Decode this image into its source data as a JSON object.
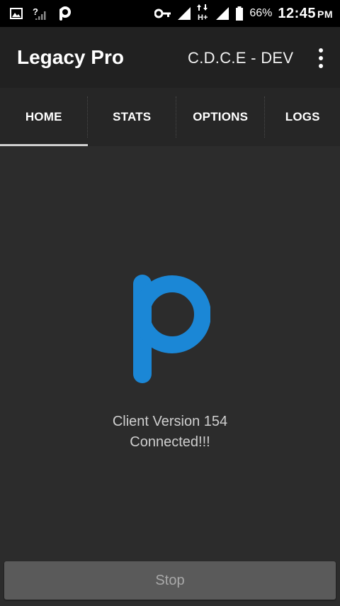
{
  "status_bar": {
    "left_icons": [
      "image-icon",
      "signal-off-icon",
      "app-p-icon"
    ],
    "right_icons": [
      "key-icon",
      "signal-icon",
      "data-arrows-icon",
      "signal-icon-2",
      "battery-icon"
    ],
    "network_type": "H+",
    "battery_percent": "66%",
    "time": "12:45",
    "ampm": "PM"
  },
  "toolbar": {
    "title": "Legacy Pro",
    "subtitle": "C.D.C.E - DEV",
    "menu_icon": "more-vert-icon"
  },
  "tabs": [
    {
      "label": "HOME",
      "selected": true
    },
    {
      "label": "STATS",
      "selected": false
    },
    {
      "label": "OPTIONS",
      "selected": false
    },
    {
      "label": "LOGS",
      "selected": false
    }
  ],
  "main": {
    "logo_icon": "p-logo-icon",
    "client_version": "Client Version 154",
    "status": "Connected!!!"
  },
  "footer": {
    "stop_label": "Stop"
  },
  "colors": {
    "accent": "#1b87d6",
    "background": "#2c2c2c",
    "toolbar": "#212121",
    "button": "#5a5a5a"
  }
}
